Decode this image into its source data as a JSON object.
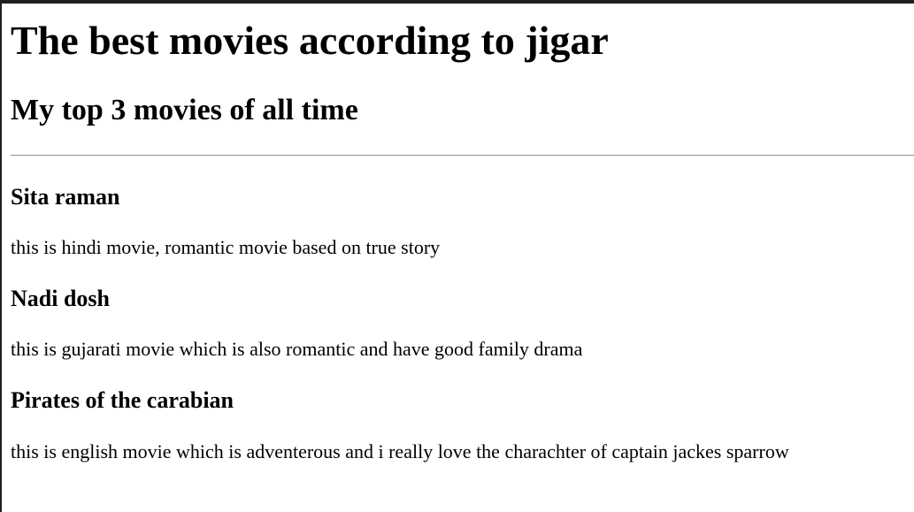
{
  "page": {
    "heading": "The best movies according to jigar",
    "subheading": "My top 3 movies of all time"
  },
  "movies": [
    {
      "title": "Sita raman",
      "description": "this is hindi movie, romantic movie based on true story"
    },
    {
      "title": "Nadi dosh",
      "description": "this is gujarati movie which is also romantic and have good family drama"
    },
    {
      "title": "Pirates of the carabian",
      "description": "this is english movie which is adventerous and i really love the charachter of captain jackes sparrow"
    }
  ]
}
